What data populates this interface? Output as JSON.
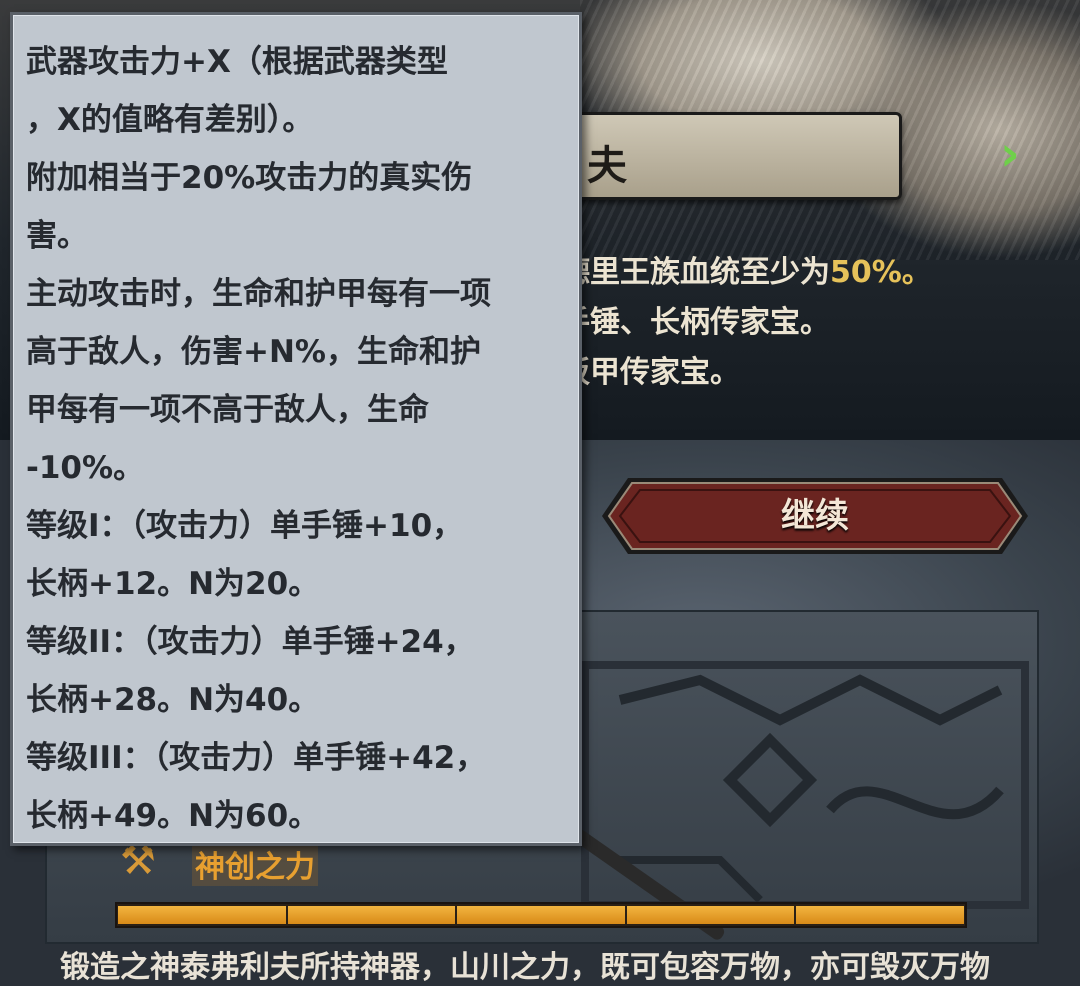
{
  "tooltip": {
    "lines": [
      "武器攻击力+X（根据武器类型",
      "，X的值略有差别）。",
      "附加相当于20%攻击力的真实伤",
      "害。",
      "主动攻击时，生命和护甲每有一项",
      "高于敌人，伤害+N%，生命和护",
      "甲每有一项不高于敌人，生命",
      "-10%。",
      "等级I：（攻击力）单手锤+10，",
      "长柄+12。N为20。",
      "等级II：（攻击力）单手锤+24，",
      "长柄+28。N为40。",
      "等级III：（攻击力）单手锤+42，",
      "长柄+49。N为60。"
    ]
  },
  "hero": {
    "name_fragment": "夫",
    "requirements": {
      "line1_prefix": "德里王族血统至少为",
      "line1_value": "50%。",
      "line2": "手锤、长柄传家宝。",
      "line3": "板甲传家宝。"
    }
  },
  "continue_button": {
    "label": "继续"
  },
  "relic": {
    "name": "神创之力",
    "progress_segments": 5,
    "progress_fraction": 1.0,
    "description": "锻造之神泰弗利夫所持神器，山川之力，既可包容万物，亦可毁灭万物"
  },
  "colors": {
    "tooltip_bg": "#c0c7cf",
    "tooltip_text": "#262a30",
    "accent_gold": "#e6c25a",
    "relic_name": "#e8a030",
    "progress_fill": "#f3b540",
    "next_arrow": "#6fd04a",
    "button_fill": "#6a2420"
  },
  "icons": {
    "next": "chevron-right-icon",
    "relic": "hammer-icon"
  }
}
